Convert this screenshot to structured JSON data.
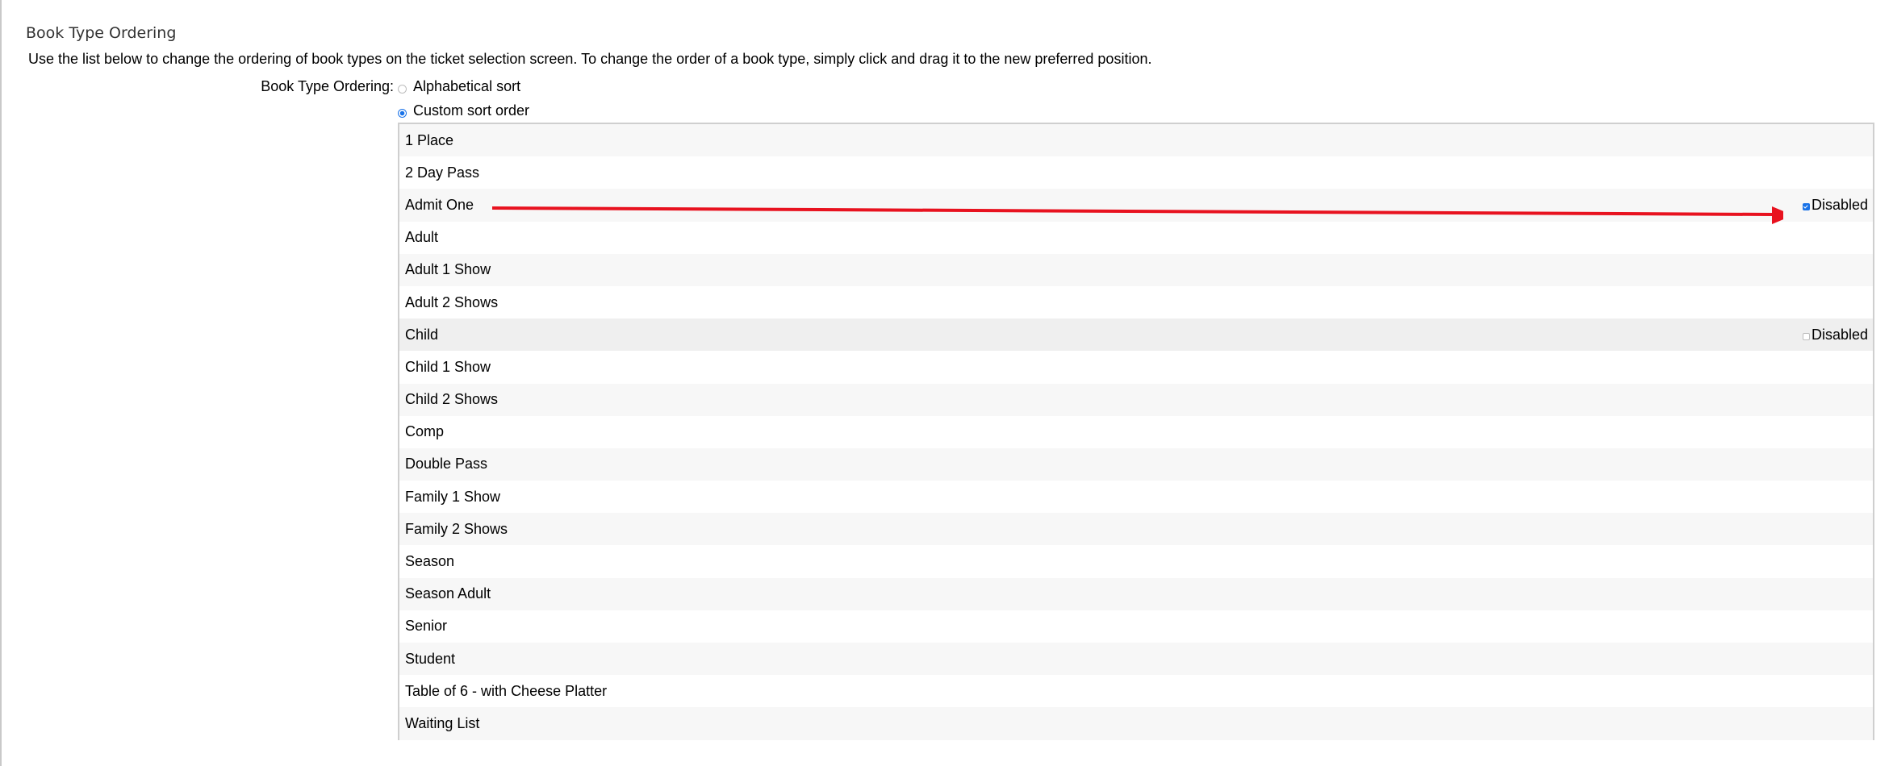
{
  "section": {
    "title": "Book Type Ordering",
    "description": "Use the list below to change the ordering of book types on the ticket selection screen. To change the order of a book type, simply click and drag it to the new preferred position."
  },
  "ordering": {
    "label": "Book Type Ordering:",
    "options": [
      {
        "label": "Alphabetical sort",
        "selected": false
      },
      {
        "label": "Custom sort order",
        "selected": true
      }
    ]
  },
  "book_types": [
    {
      "name": "1 Place"
    },
    {
      "name": "2 Day Pass"
    },
    {
      "name": "Admit One",
      "disabled_label": "Disabled",
      "disabled_checked": true
    },
    {
      "name": "Adult"
    },
    {
      "name": "Adult 1 Show"
    },
    {
      "name": "Adult 2 Shows"
    },
    {
      "name": "Child",
      "disabled_label": "Disabled",
      "disabled_checked": false,
      "hovered": true
    },
    {
      "name": "Child 1 Show"
    },
    {
      "name": "Child 2 Shows"
    },
    {
      "name": "Comp"
    },
    {
      "name": "Double Pass"
    },
    {
      "name": "Family 1 Show"
    },
    {
      "name": "Family 2 Shows"
    },
    {
      "name": "Season"
    },
    {
      "name": "Season Adult"
    },
    {
      "name": "Senior"
    },
    {
      "name": "Student"
    },
    {
      "name": "Table of 6 - with Cheese Platter"
    },
    {
      "name": "Waiting List"
    }
  ],
  "colors": {
    "annotation_arrow": "#e8121f",
    "accent": "#1a73e8"
  }
}
